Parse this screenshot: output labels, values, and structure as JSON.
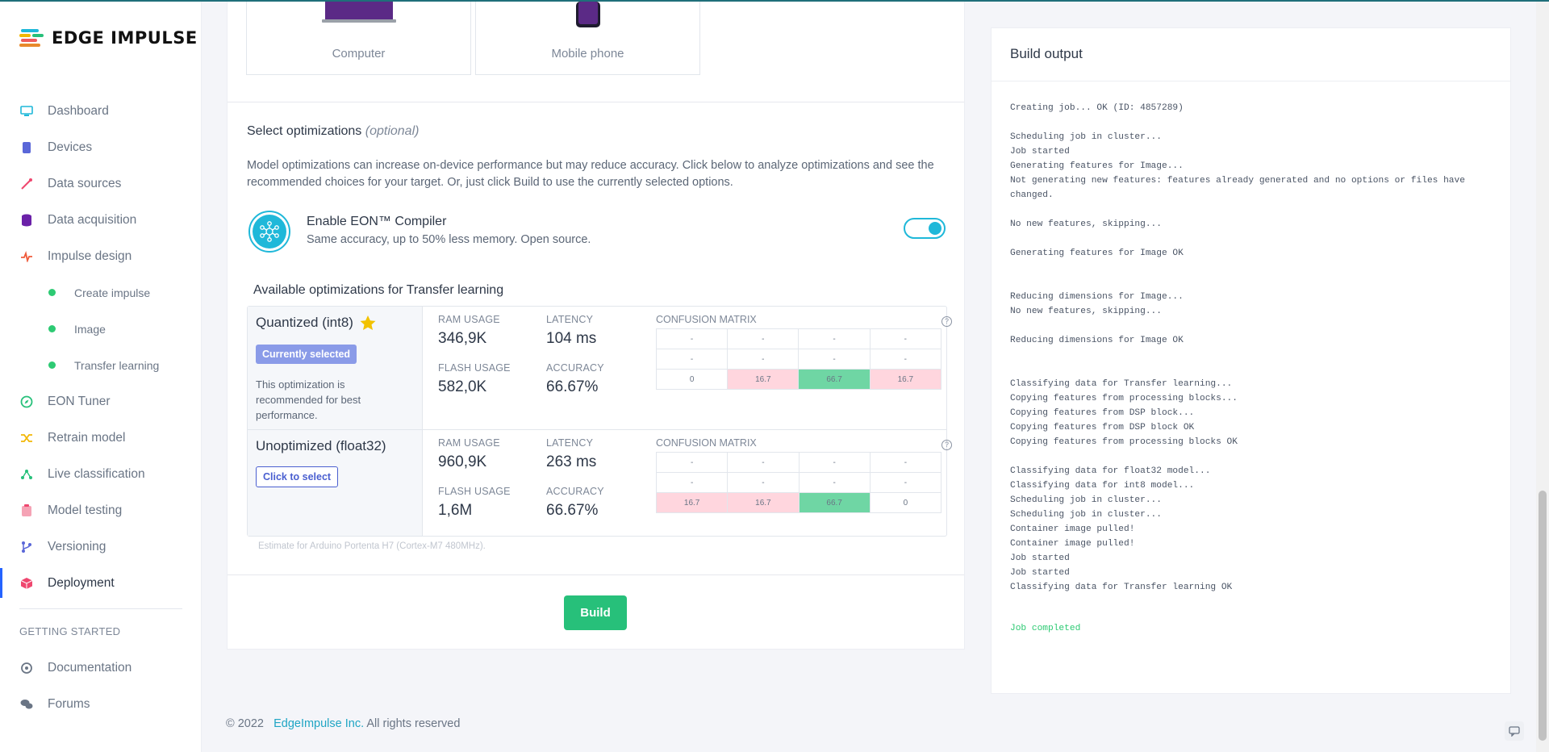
{
  "brand": {
    "name": "EDGE IMPULSE"
  },
  "sidebar": {
    "items": [
      {
        "label": "Dashboard"
      },
      {
        "label": "Devices"
      },
      {
        "label": "Data sources"
      },
      {
        "label": "Data acquisition"
      },
      {
        "label": "Impulse design"
      },
      {
        "label": "Create impulse"
      },
      {
        "label": "Image"
      },
      {
        "label": "Transfer learning"
      },
      {
        "label": "EON Tuner"
      },
      {
        "label": "Retrain model"
      },
      {
        "label": "Live classification"
      },
      {
        "label": "Model testing"
      },
      {
        "label": "Versioning"
      },
      {
        "label": "Deployment"
      }
    ],
    "getting_started": {
      "title": "GETTING STARTED",
      "items": [
        {
          "label": "Documentation"
        },
        {
          "label": "Forums"
        }
      ]
    }
  },
  "targets": [
    {
      "label": "Computer"
    },
    {
      "label": "Mobile phone"
    }
  ],
  "optimizations": {
    "title": "Select optimizations",
    "title_optional": "(optional)",
    "description": "Model optimizations can increase on-device performance but may reduce accuracy. Click below to analyze optimizations and see the recommended choices for your target. Or, just click Build to use the currently selected options.",
    "eon": {
      "title": "Enable EON™ Compiler",
      "subtitle": "Same accuracy, up to 50% less memory. Open source.",
      "enabled": true
    },
    "available_title": "Available optimizations for Transfer learning",
    "labels": {
      "ram": "RAM USAGE",
      "latency": "LATENCY",
      "flash": "FLASH USAGE",
      "accuracy": "ACCURACY",
      "confusion": "CONFUSION MATRIX",
      "help": "?"
    },
    "rows": [
      {
        "name": "Quantized (int8)",
        "badge": "Currently selected",
        "note": "This optimization is recommended for best performance.",
        "ram": "346,9K",
        "latency": "104 ms",
        "flash": "582,0K",
        "accuracy": "66.67%",
        "matrix": [
          [
            "-",
            "-",
            "-",
            "-"
          ],
          [
            "-",
            "-",
            "-",
            "-"
          ],
          [
            "0",
            "16.7",
            "66.7",
            "16.7"
          ]
        ]
      },
      {
        "name": "Unoptimized (float32)",
        "button": "Click to select",
        "ram": "960,9K",
        "latency": "263 ms",
        "flash": "1,6M",
        "accuracy": "66.67%",
        "matrix": [
          [
            "-",
            "-",
            "-",
            "-"
          ],
          [
            "-",
            "-",
            "-",
            "-"
          ],
          [
            "16.7",
            "16.7",
            "66.7",
            "0"
          ]
        ]
      }
    ],
    "estimate": "Estimate for Arduino Portenta H7 (Cortex-M7 480MHz).",
    "build_label": "Build"
  },
  "build_output": {
    "title": "Build output",
    "log": "Creating job... OK (ID: 4857289)\n\nScheduling job in cluster...\nJob started\nGenerating features for Image...\nNot generating new features: features already generated and no options or files have\nchanged.\n\nNo new features, skipping...\n\nGenerating features for Image OK\n\n\nReducing dimensions for Image...\nNo new features, skipping...\n\nReducing dimensions for Image OK\n\n\nClassifying data for Transfer learning...\nCopying features from processing blocks...\nCopying features from DSP block...\nCopying features from DSP block OK\nCopying features from processing blocks OK\n\nClassifying data for float32 model...\nClassifying data for int8 model...\nScheduling job in cluster...\nScheduling job in cluster...\nContainer image pulled!\nContainer image pulled!\nJob started\nJob started\nClassifying data for Transfer learning OK",
    "done": "Job completed"
  },
  "footer": {
    "copyright": "© 2022",
    "company": "EdgeImpulse Inc.",
    "rights": "All rights reserved"
  },
  "colors": {
    "accent": "#1fb8d9",
    "build": "#27c07a",
    "active_bar": "#2563ff",
    "pink": "#ffd6de",
    "green": "#6fd6a4"
  }
}
